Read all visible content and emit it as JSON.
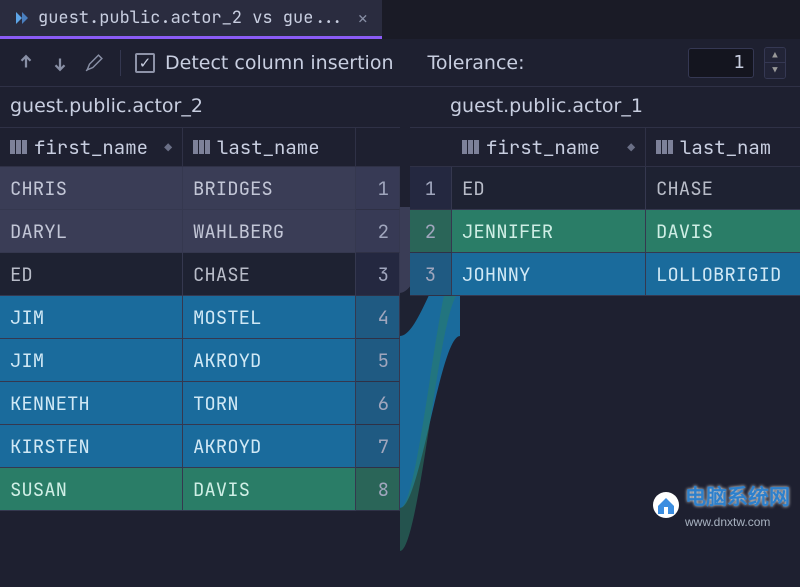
{
  "tab": {
    "title": "guest.public.actor_2 vs gue..."
  },
  "toolbar": {
    "detect_label": "Detect column insertion",
    "detect_checked": true,
    "tolerance_label": "Tolerance:",
    "tolerance_value": "1"
  },
  "left": {
    "title": "guest.public.actor_2",
    "columns": [
      "first_name",
      "last_name"
    ],
    "rows": [
      {
        "n": "1",
        "first_name": "CHRIS",
        "last_name": "BRIDGES",
        "cls": "gray"
      },
      {
        "n": "2",
        "first_name": "DARYL",
        "last_name": "WAHLBERG",
        "cls": "gray"
      },
      {
        "n": "3",
        "first_name": "ED",
        "last_name": "CHASE",
        "cls": "dark"
      },
      {
        "n": "4",
        "first_name": "JIM",
        "last_name": "MOSTEL",
        "cls": "blue"
      },
      {
        "n": "5",
        "first_name": "JIM",
        "last_name": "AKROYD",
        "cls": "blue"
      },
      {
        "n": "6",
        "first_name": "KENNETH",
        "last_name": "TORN",
        "cls": "blue"
      },
      {
        "n": "7",
        "first_name": "KIRSTEN",
        "last_name": "AKROYD",
        "cls": "blue"
      },
      {
        "n": "8",
        "first_name": "SUSAN",
        "last_name": "DAVIS",
        "cls": "teal"
      }
    ]
  },
  "right": {
    "title": "guest.public.actor_1",
    "columns": [
      "first_name",
      "last_nam"
    ],
    "rows": [
      {
        "n": "1",
        "first_name": "ED",
        "last_name": "CHASE",
        "cls": "dark"
      },
      {
        "n": "2",
        "first_name": "JENNIFER",
        "last_name": "DAVIS",
        "cls": "teal"
      },
      {
        "n": "3",
        "first_name": "JOHNNY",
        "last_name": "LOLLOBRIGID",
        "cls": "blue"
      }
    ]
  },
  "watermark": {
    "text": "电脑系统网",
    "domain": "www.dnxtw.com"
  }
}
